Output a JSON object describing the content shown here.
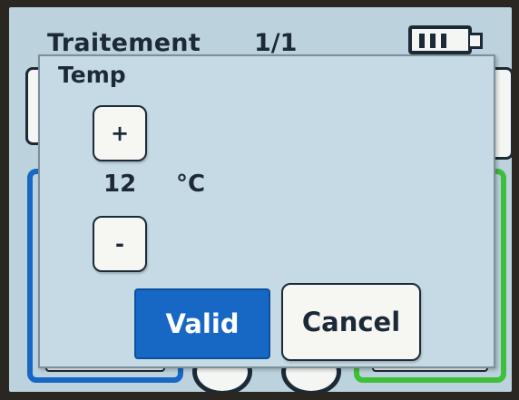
{
  "header": {
    "title": "Traitement",
    "page_indicator": "1/1",
    "battery_icon": "battery-icon"
  },
  "dialog": {
    "title": "Temp",
    "increment_label": "+",
    "decrement_label": "-",
    "value": "12",
    "unit": "°C",
    "valid_label": "Valid",
    "cancel_label": "Cancel"
  },
  "colors": {
    "screen_background": "#bcd3de",
    "dialog_background": "#c5dae4",
    "accent_blue": "#1668c4",
    "accent_green": "#3fbf3a",
    "text_dark": "#1c2a38"
  }
}
